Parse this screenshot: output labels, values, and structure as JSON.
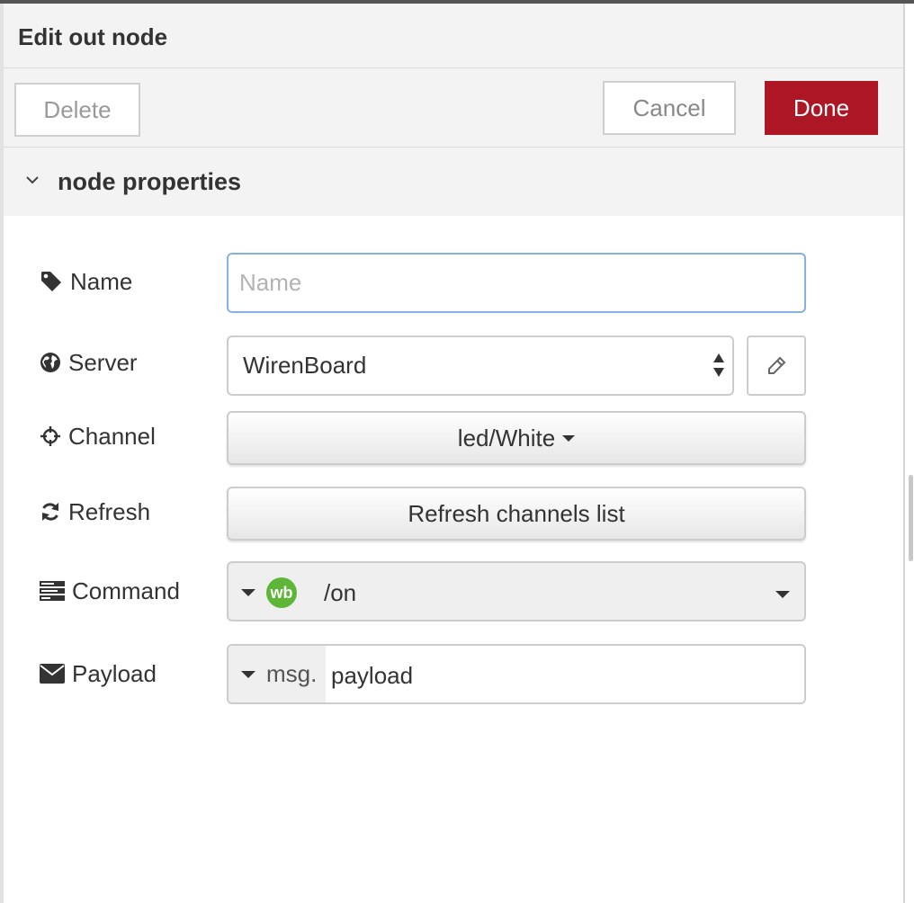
{
  "dialog": {
    "title": "Edit out node",
    "delete_label": "Delete",
    "cancel_label": "Cancel",
    "done_label": "Done"
  },
  "section": {
    "title": "node properties"
  },
  "fields": {
    "name": {
      "label": "Name",
      "placeholder": "Name",
      "value": ""
    },
    "server": {
      "label": "Server",
      "value": "WirenBoard"
    },
    "channel": {
      "label": "Channel",
      "value": "led/White"
    },
    "refresh": {
      "label": "Refresh",
      "button_label": "Refresh channels list"
    },
    "command": {
      "label": "Command",
      "type_badge": "wb",
      "value": "/on"
    },
    "payload": {
      "label": "Payload",
      "type_prefix": "msg.",
      "value": "payload"
    }
  },
  "colors": {
    "done_button": "#ad1625",
    "wb_badge": "#5db637",
    "focus_border": "#85b2e2"
  },
  "icons": {
    "name": "tag-icon",
    "server": "globe-icon",
    "channel": "crosshairs-icon",
    "refresh": "refresh-icon",
    "command": "tasks-icon",
    "payload": "envelope-icon",
    "edit": "pencil-icon",
    "section_toggle": "chevron-down-icon"
  }
}
